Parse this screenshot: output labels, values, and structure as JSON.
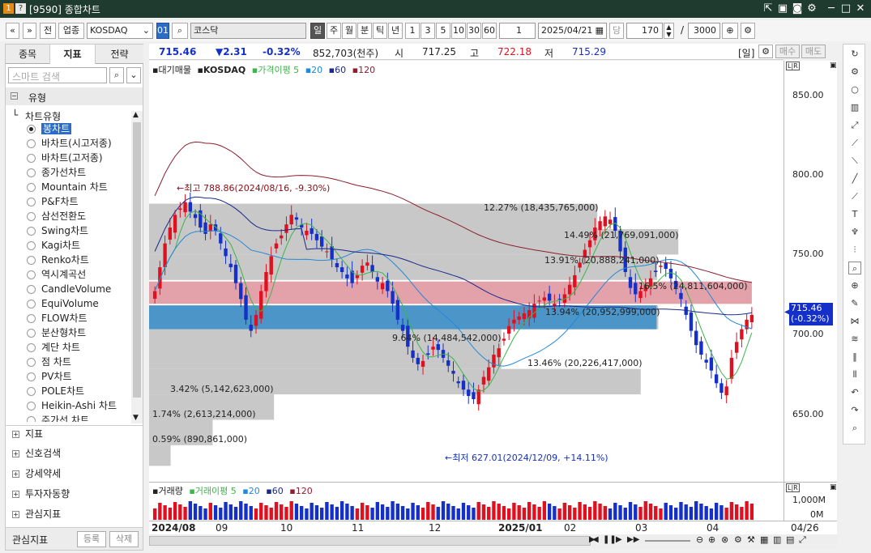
{
  "window": {
    "title": "[9590] 종합차트",
    "icon_left": "1",
    "icon_help": "?"
  },
  "toolbar": {
    "nav_prev": "«",
    "nav_down": "»",
    "btn_jeon": "전",
    "btn_upjong": "업종",
    "market_select": "KOSDAQ",
    "code": "01",
    "search_icon": "search-icon",
    "name": "코스닥",
    "periods": [
      "일",
      "주",
      "월",
      "분",
      "틱",
      "년"
    ],
    "active_period": "일",
    "intervals": [
      "1",
      "3",
      "5",
      "10",
      "30",
      "60"
    ],
    "count_value": "1",
    "date": "2025/04/21",
    "dang": "당",
    "amount": "170",
    "slash": "/",
    "max_amount": "3000"
  },
  "left_panel": {
    "tabs": [
      "종목",
      "지표",
      "전략"
    ],
    "active_tab": "지표",
    "search_placeholder": "스마트 검색",
    "group": "유형",
    "subgroup": "차트유형",
    "chart_types": [
      "봉차트",
      "바차트(시고저종)",
      "바차트(고저종)",
      "종가선차트",
      "Mountain 차트",
      "P&F차트",
      "삼선전환도",
      "Swing차트",
      "Kagi차트",
      "Renko차트",
      "역시계곡선",
      "CandleVolume",
      "EquiVolume",
      "FLOW차트",
      "분산형차트",
      "계단 차트",
      "점 차트",
      "PV차트",
      "POLE차트",
      "Heikin-Ashi 차트",
      "주가선 차트"
    ],
    "selected_type": "봉차트",
    "footer_items": [
      "지표",
      "신호검색",
      "강세약세",
      "투자자동향",
      "관심지표"
    ],
    "bottom_label": "관심지표",
    "btn_register": "등록",
    "btn_delete": "삭제"
  },
  "price_bar": {
    "price": "715.46",
    "change": "▼2.31",
    "change_pct": "-0.32%",
    "volume": "852,703(천주)",
    "open_label": "시",
    "open": "717.25",
    "high_label": "고",
    "high": "722.18",
    "low_label": "저",
    "low": "715.29",
    "period_tag": "[일]",
    "buy": "매수",
    "sell": "매도"
  },
  "legend": {
    "title": "대기매물",
    "symbol": "KOSDAQ",
    "ma_label": "가격이평 5",
    "ma20": "20",
    "ma60": "60",
    "ma120": "120"
  },
  "volume_legend": {
    "title": "거래량",
    "ma_label": "거래이평 5",
    "ma20": "20",
    "ma60": "60",
    "ma120": "120"
  },
  "annotations": {
    "high": "←최고 788.86(2024/08/16, -9.30%)",
    "low": "←최저 627.01(2024/12/09, +14.11%)"
  },
  "volume_profile": [
    {
      "label": "0.59% (890,861,000)"
    },
    {
      "label": "1.74% (2,613,214,000)"
    },
    {
      "label": "3.42% (5,142,623,000)"
    },
    {
      "label": "13.46% (20,226,417,000)"
    },
    {
      "label": "9.64% (14,484,542,000)"
    },
    {
      "label": "13.94% (20,952,999,000)"
    },
    {
      "label": "16.5% (24,811,604,000)"
    },
    {
      "label": "13.91% (20,888,241,000)"
    },
    {
      "label": "14.49% (21,769,091,000)"
    },
    {
      "label": "12.27% (18,435,765,000)"
    }
  ],
  "y_axis": {
    "ticks": [
      "850.00",
      "800.00",
      "750.00",
      "700.00",
      "650.00"
    ],
    "current": "715.46",
    "current_pct": "(-0.32%)",
    "lr": "L|R"
  },
  "vol_axis": {
    "ticks": [
      "1,000M",
      "0M"
    ],
    "lr": "L|R"
  },
  "x_axis": {
    "labels": [
      "2024/08",
      "09",
      "10",
      "11",
      "12",
      "2025/01",
      "02",
      "03",
      "04"
    ],
    "right_date": "04/26"
  },
  "colors": {
    "up": "#e0101e",
    "down": "#1530c8",
    "ma5": "#3cb54a",
    "ma20": "#2488d8",
    "ma60": "#1a2a8a",
    "ma120": "#8b1f2e"
  },
  "chart_data": {
    "type": "candlestick",
    "ylim": [
      610,
      875
    ],
    "highlight_band_pink": [
      722,
      736
    ],
    "highlight_band_blue": [
      706,
      721
    ],
    "profile_bands": [
      {
        "low": 620,
        "high": 633,
        "pct": 0.59
      },
      {
        "low": 633,
        "high": 649,
        "pct": 1.74
      },
      {
        "low": 649,
        "high": 665,
        "pct": 3.42
      },
      {
        "low": 665,
        "high": 681,
        "pct": 13.46
      },
      {
        "low": 681,
        "high": 706,
        "pct": 9.64
      },
      {
        "low": 706,
        "high": 721,
        "pct": 13.94
      },
      {
        "low": 722,
        "high": 736,
        "pct": 16.5
      },
      {
        "low": 737,
        "high": 753,
        "pct": 13.91
      },
      {
        "low": 753,
        "high": 769,
        "pct": 14.49
      },
      {
        "low": 769,
        "high": 785,
        "pct": 12.27
      }
    ],
    "closes": [
      730,
      745,
      760,
      770,
      778,
      782,
      786,
      780,
      776,
      770,
      766,
      772,
      768,
      760,
      752,
      745,
      735,
      725,
      712,
      705,
      715,
      730,
      742,
      752,
      760,
      765,
      772,
      778,
      775,
      770,
      768,
      766,
      762,
      758,
      755,
      750,
      745,
      742,
      738,
      735,
      740,
      746,
      748,
      742,
      736,
      735,
      730,
      722,
      712,
      705,
      695,
      688,
      684,
      686,
      690,
      695,
      693,
      688,
      683,
      678,
      672,
      668,
      664,
      662,
      668,
      676,
      682,
      690,
      694,
      700,
      708,
      712,
      714,
      716,
      718,
      722,
      724,
      726,
      724,
      722,
      725,
      728,
      734,
      740,
      748,
      756,
      762,
      770,
      774,
      777,
      775,
      768,
      755,
      742,
      732,
      728,
      730,
      734,
      738,
      742,
      746,
      744,
      738,
      732,
      725,
      715,
      705,
      696,
      690,
      685,
      680,
      672,
      666,
      670,
      688,
      698,
      706,
      712,
      715
    ],
    "high_point": {
      "value": 788.86,
      "date": "2024/08/16"
    },
    "low_point": {
      "value": 627.01,
      "date": "2024/12/09"
    }
  }
}
